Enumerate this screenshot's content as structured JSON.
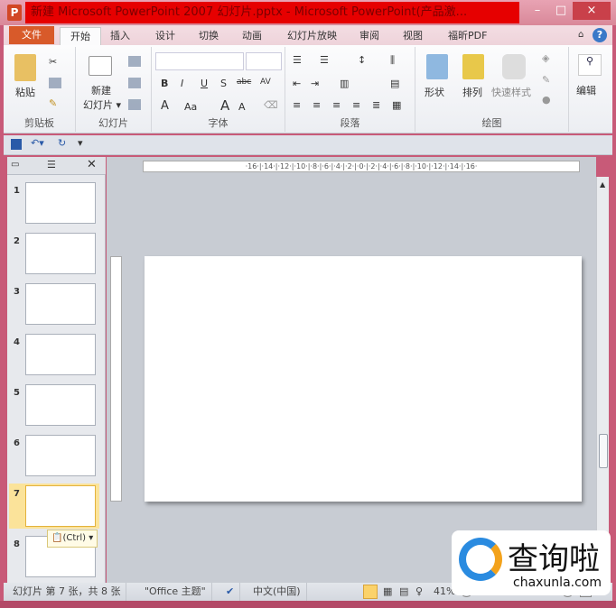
{
  "window": {
    "title": "新建 Microsoft PowerPoint 2007 幻灯片.pptx - Microsoft PowerPoint(产品激...",
    "app_icon": "P",
    "minimize": "–",
    "maximize": "□",
    "close": "×"
  },
  "tabs": [
    "文件",
    "开始",
    "插入",
    "设计",
    "切换",
    "动画",
    "幻灯片放映",
    "审阅",
    "视图",
    "福昕PDF"
  ],
  "help": "?",
  "ribbon": {
    "clipboard": {
      "paste": "粘贴",
      "label": "剪贴板"
    },
    "slides": {
      "new_slide": "新建",
      "new_slide2": "幻灯片 ▾",
      "label": "幻灯片"
    },
    "font": {
      "label": "字体",
      "bold": "B",
      "italic": "I",
      "underline": "U",
      "shadow": "S",
      "strike": "abc",
      "spacing": "AV",
      "color": "A",
      "case": "Aa",
      "grow": "A",
      "shrink": "A"
    },
    "paragraph": {
      "label": "段落"
    },
    "drawing": {
      "shapes": "形状",
      "arrange": "排列",
      "quick_styles": "快速样式",
      "label": "绘图"
    },
    "editing": {
      "label": "编辑"
    }
  },
  "ruler": "·16·|·14·|·12·|·10·|·8·|·6·|·4·|·2·|·0·|·2·|·4·|·6·|·8·|·10·|·12·|·14·|·16·",
  "slides": [
    {
      "n": "1"
    },
    {
      "n": "2"
    },
    {
      "n": "3"
    },
    {
      "n": "4"
    },
    {
      "n": "5"
    },
    {
      "n": "6"
    },
    {
      "n": "7"
    },
    {
      "n": "8"
    }
  ],
  "selected_slide": 7,
  "paste_options": "(Ctrl) ▾",
  "status": {
    "slide": "幻灯片 第 7 张，共 8 张",
    "theme": "\"Office 主题\"",
    "language": "中文(中国)",
    "zoom": "41%",
    "zoom_out": "−",
    "zoom_in": "+"
  },
  "watermark": {
    "text": "查询啦",
    "url": "chaxunla.com"
  },
  "colors": {
    "accent": "#d85a2a",
    "selection": "#fbe39a",
    "title_highlight": "#e60000"
  }
}
